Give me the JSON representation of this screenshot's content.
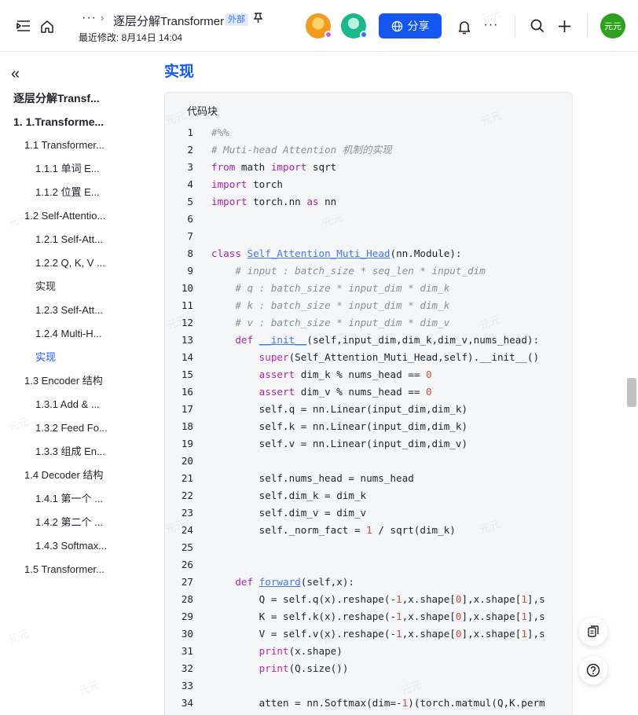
{
  "topbar": {
    "more_label": "···",
    "breadcrumb_separator": "›",
    "doc_title": "逐层分解Transformer",
    "external_tag": "外部",
    "last_modified": "最近修改: 8月14日 14:04",
    "share_label": "分享",
    "user_avatar_text": "元元"
  },
  "sidebar": {
    "collapse_glyph": "«",
    "doc_title": "逐层分解Transf...",
    "items": [
      {
        "label": "1. 1.Transforme..."
      },
      {
        "label": "1.1 Transformer..."
      },
      {
        "label": "1.1.1 单词 E..."
      },
      {
        "label": "1.1.2 位置 E..."
      },
      {
        "label": "1.2 Self-Attentio..."
      },
      {
        "label": "1.2.1 Self-Att..."
      },
      {
        "label": "1.2.2 Q, K, V ..."
      },
      {
        "label": "实现"
      },
      {
        "label": "1.2.3 Self-Att..."
      },
      {
        "label": "1.2.4 Multi-H..."
      },
      {
        "label": "实现"
      },
      {
        "label": "1.3 Encoder 结构"
      },
      {
        "label": "1.3.1 Add & ..."
      },
      {
        "label": "1.3.2 Feed Fo..."
      },
      {
        "label": "1.3.3 组成 En..."
      },
      {
        "label": "1.4 Decoder 结构"
      },
      {
        "label": "1.4.1 第一个 ..."
      },
      {
        "label": "1.4.2 第二个 ..."
      },
      {
        "label": "1.4.3 Softmax..."
      },
      {
        "label": "1.5 Transformer..."
      }
    ]
  },
  "main": {
    "heading": "实现",
    "code_block_label": "代码块",
    "code": [
      {
        "n": "1",
        "t": "#%%"
      },
      {
        "n": "2",
        "t": "# Muti-head Attention 机制的实现"
      },
      {
        "n": "3",
        "t": "from math import sqrt"
      },
      {
        "n": "4",
        "t": "import torch"
      },
      {
        "n": "5",
        "t": "import torch.nn as nn"
      },
      {
        "n": "6",
        "t": ""
      },
      {
        "n": "7",
        "t": ""
      },
      {
        "n": "8",
        "t": "class Self_Attention_Muti_Head(nn.Module):"
      },
      {
        "n": "9",
        "t": "    # input : batch_size * seq_len * input_dim"
      },
      {
        "n": "10",
        "t": "    # q : batch_size * input_dim * dim_k"
      },
      {
        "n": "11",
        "t": "    # k : batch_size * input_dim * dim_k"
      },
      {
        "n": "12",
        "t": "    # v : batch_size * input_dim * dim_v"
      },
      {
        "n": "13",
        "t": "    def __init__(self,input_dim,dim_k,dim_v,nums_head):"
      },
      {
        "n": "14",
        "t": "        super(Self_Attention_Muti_Head,self).__init__()"
      },
      {
        "n": "15",
        "t": "        assert dim_k % nums_head == 0"
      },
      {
        "n": "16",
        "t": "        assert dim_v % nums_head == 0"
      },
      {
        "n": "17",
        "t": "        self.q = nn.Linear(input_dim,dim_k)"
      },
      {
        "n": "18",
        "t": "        self.k = nn.Linear(input_dim,dim_k)"
      },
      {
        "n": "19",
        "t": "        self.v = nn.Linear(input_dim,dim_v)"
      },
      {
        "n": "20",
        "t": ""
      },
      {
        "n": "21",
        "t": "        self.nums_head = nums_head"
      },
      {
        "n": "22",
        "t": "        self.dim_k = dim_k"
      },
      {
        "n": "23",
        "t": "        self.dim_v = dim_v"
      },
      {
        "n": "24",
        "t": "        self._norm_fact = 1 / sqrt(dim_k)"
      },
      {
        "n": "25",
        "t": ""
      },
      {
        "n": "26",
        "t": ""
      },
      {
        "n": "27",
        "t": "    def forward(self,x):"
      },
      {
        "n": "28",
        "t": "        Q = self.q(x).reshape(-1,x.shape[0],x.shape[1],s"
      },
      {
        "n": "29",
        "t": "        K = self.k(x).reshape(-1,x.shape[0],x.shape[1],s"
      },
      {
        "n": "30",
        "t": "        V = self.v(x).reshape(-1,x.shape[0],x.shape[1],s"
      },
      {
        "n": "31",
        "t": "        print(x.shape)"
      },
      {
        "n": "32",
        "t": "        print(Q.size())"
      },
      {
        "n": "33",
        "t": ""
      },
      {
        "n": "34",
        "t": "        atten = nn.Softmax(dim=-1)(torch.matmul(Q,K.perm"
      }
    ]
  },
  "watermark_text": "元元",
  "colors": {
    "accent": "#1456f0",
    "code_bg": "#f5f6f7",
    "keyword": "#a626a4",
    "comment": "#8a8f98",
    "number": "#d34a3a"
  }
}
